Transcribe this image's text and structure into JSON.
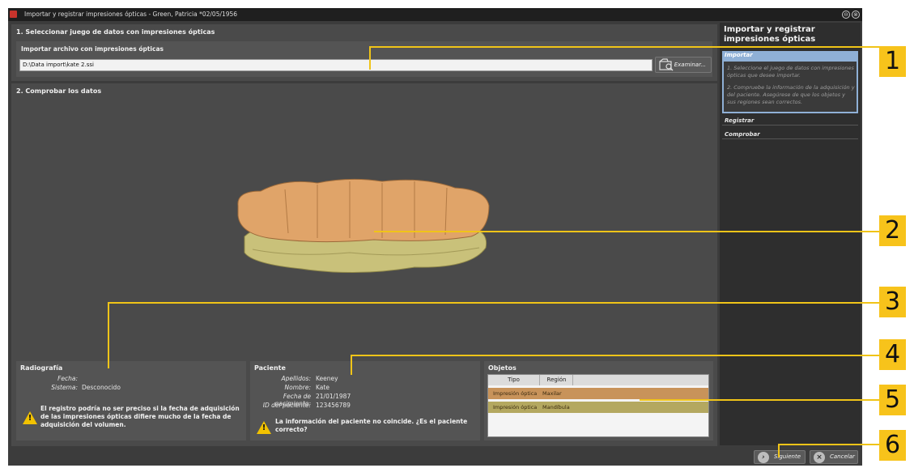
{
  "window": {
    "title": "Importar y registrar impresiones ópticas - Green, Patricia *02/05/1956",
    "minimize_glyph": "⊖",
    "close_glyph": "⊗"
  },
  "section1": {
    "title": "1. Seleccionar juego de datos con impresiones ópticas",
    "import_label": "Importar archivo con impresiones ópticas",
    "file_path": "D:\\Data import\\kate 2.ssi",
    "browse_label": "Examinar..."
  },
  "section2": {
    "title": "2. Comprobar los datos"
  },
  "radiografia": {
    "title": "Radiografía",
    "fecha_label": "Fecha:",
    "fecha_value": "",
    "sistema_label": "Sistema:",
    "sistema_value": "Desconocido",
    "warning": "El registro podría no ser preciso si la fecha de adquisición de las impresiones ópticas difiere mucho de la fecha de adquisición del volumen."
  },
  "paciente": {
    "title": "Paciente",
    "apellidos_label": "Apellidos:",
    "apellidos_value": "Keeney",
    "nombre_label": "Nombre:",
    "nombre_value": "Kate",
    "nacimiento_label": "Fecha de nacimiento:",
    "nacimiento_value": "21/01/1987",
    "id_label": "ID del paciente:",
    "id_value": "123456789",
    "warning": "La información del paciente no coincide. ¿Es el paciente correcto?"
  },
  "objetos": {
    "title": "Objetos",
    "col_tipo": "Tipo",
    "col_region": "Región",
    "rows": [
      {
        "tipo": "Impresión óptica",
        "region": "Maxilar",
        "color": "#c8935a"
      },
      {
        "tipo": "Impresión óptica",
        "region": "Mandíbula",
        "color": "#b4a860"
      }
    ]
  },
  "sidebar": {
    "title": "Importar y registrar impresiones ópticas",
    "steps": [
      {
        "label": "Importar",
        "active": true
      },
      {
        "label": "Registrar",
        "active": false
      },
      {
        "label": "Comprobar",
        "active": false
      }
    ],
    "instructions": [
      "1. Seleccione el juego de datos con impresiones ópticas que desee importar.",
      "2. Compruebe la información de la adquisición y del paciente. Asegúrese de que los objetos y sus regiones sean correctos."
    ]
  },
  "buttons": {
    "next": "Siguiente",
    "cancel": "Cancelar"
  },
  "callouts": [
    "1",
    "2",
    "3",
    "4",
    "5",
    "6"
  ],
  "colors": {
    "accent": "#f0c418",
    "step_active": "#8fb0d6"
  }
}
